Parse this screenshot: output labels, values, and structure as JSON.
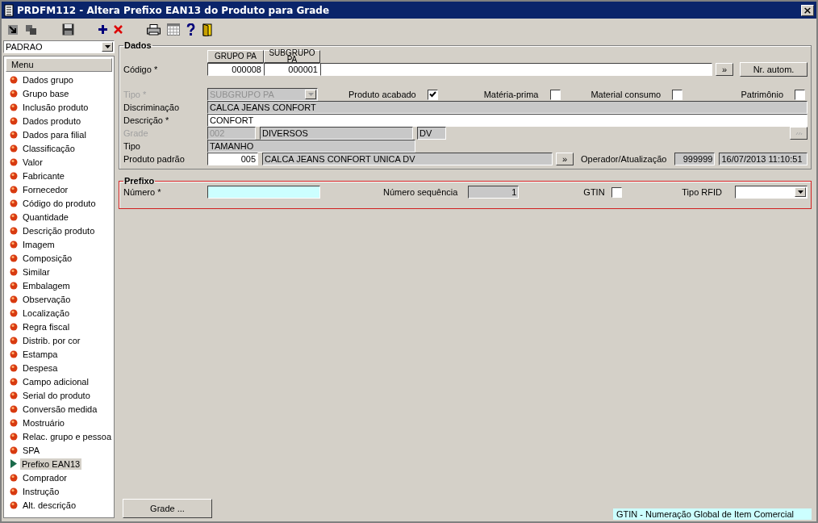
{
  "window": {
    "title": "PRDFM112 - Altera Prefixo EAN13 do Produto para Grade",
    "close": "×"
  },
  "profile": {
    "value": "PADRAO"
  },
  "menu": {
    "header": "Menu",
    "items": [
      {
        "label": "Dados grupo",
        "selected": false
      },
      {
        "label": "Grupo base",
        "selected": false
      },
      {
        "label": "Inclusão produto",
        "selected": false
      },
      {
        "label": "Dados produto",
        "selected": false
      },
      {
        "label": "Dados para filial",
        "selected": false
      },
      {
        "label": "Classificação",
        "selected": false
      },
      {
        "label": "Valor",
        "selected": false
      },
      {
        "label": "Fabricante",
        "selected": false
      },
      {
        "label": "Fornecedor",
        "selected": false
      },
      {
        "label": "Código do produto",
        "selected": false
      },
      {
        "label": "Quantidade",
        "selected": false
      },
      {
        "label": "Descrição produto",
        "selected": false
      },
      {
        "label": "Imagem",
        "selected": false
      },
      {
        "label": "Composição",
        "selected": false
      },
      {
        "label": "Similar",
        "selected": false
      },
      {
        "label": "Embalagem",
        "selected": false
      },
      {
        "label": "Observação",
        "selected": false
      },
      {
        "label": "Localização",
        "selected": false
      },
      {
        "label": "Regra fiscal",
        "selected": false
      },
      {
        "label": "Distrib. por cor",
        "selected": false
      },
      {
        "label": "Estampa",
        "selected": false
      },
      {
        "label": "Despesa",
        "selected": false
      },
      {
        "label": "Campo adicional",
        "selected": false
      },
      {
        "label": "Serial do produto",
        "selected": false
      },
      {
        "label": "Conversão medida",
        "selected": false
      },
      {
        "label": "Mostruário",
        "selected": false
      },
      {
        "label": "Relac. grupo e pessoa",
        "selected": false
      },
      {
        "label": "SPA",
        "selected": false
      },
      {
        "label": "Prefixo EAN13",
        "selected": true
      },
      {
        "label": "Comprador",
        "selected": false
      },
      {
        "label": "Instrução",
        "selected": false
      },
      {
        "label": "Alt. descrição",
        "selected": false
      }
    ]
  },
  "dados": {
    "title": "Dados",
    "codigo": {
      "label": "Código *",
      "columns": [
        {
          "header": "GRUPO PA",
          "value": "000008"
        },
        {
          "header": "SUBGRUPO PA",
          "value": "000001"
        }
      ],
      "lookup_button": "»",
      "auto_button": "Nr. autom."
    },
    "tipo": {
      "label": "Tipo *",
      "value": "SUBGRUPO PA",
      "disabled": true
    },
    "flags": [
      {
        "label": "Produto acabado",
        "checked": true
      },
      {
        "label": "Matéria-prima",
        "checked": false
      },
      {
        "label": "Material consumo",
        "checked": false
      },
      {
        "label": "Patrimônio",
        "checked": false
      }
    ],
    "discriminacao": {
      "label": "Discriminação",
      "value": "CALCA JEANS CONFORT"
    },
    "descricao": {
      "label": "Descrição *",
      "value": "CONFORT"
    },
    "grade": {
      "label": "Grade",
      "disabled": true,
      "code": "002",
      "name": "DIVERSOS",
      "abbrev": "DV"
    },
    "tipo_grade": {
      "label": "Tipo",
      "value": "TAMANHO"
    },
    "produto_padrao": {
      "label": "Produto padrão",
      "code": "005",
      "name": "CALCA JEANS CONFORT UNICA DV",
      "lookup_button": "»"
    },
    "operador": {
      "label": "Operador/Atualização",
      "user": "999999",
      "timestamp": "16/07/2013 11:10:51"
    }
  },
  "prefixo": {
    "title": "Prefixo",
    "numero": {
      "label": "Número *"
    },
    "sequencia": {
      "label": "Número sequência",
      "value": "1"
    },
    "gtin": {
      "label": "GTIN",
      "checked": false
    },
    "tipo_rfid": {
      "label": "Tipo RFID"
    }
  },
  "grade_button": "Grade ...",
  "status_bar": "GTIN - Numeração Global de Item Comercial"
}
